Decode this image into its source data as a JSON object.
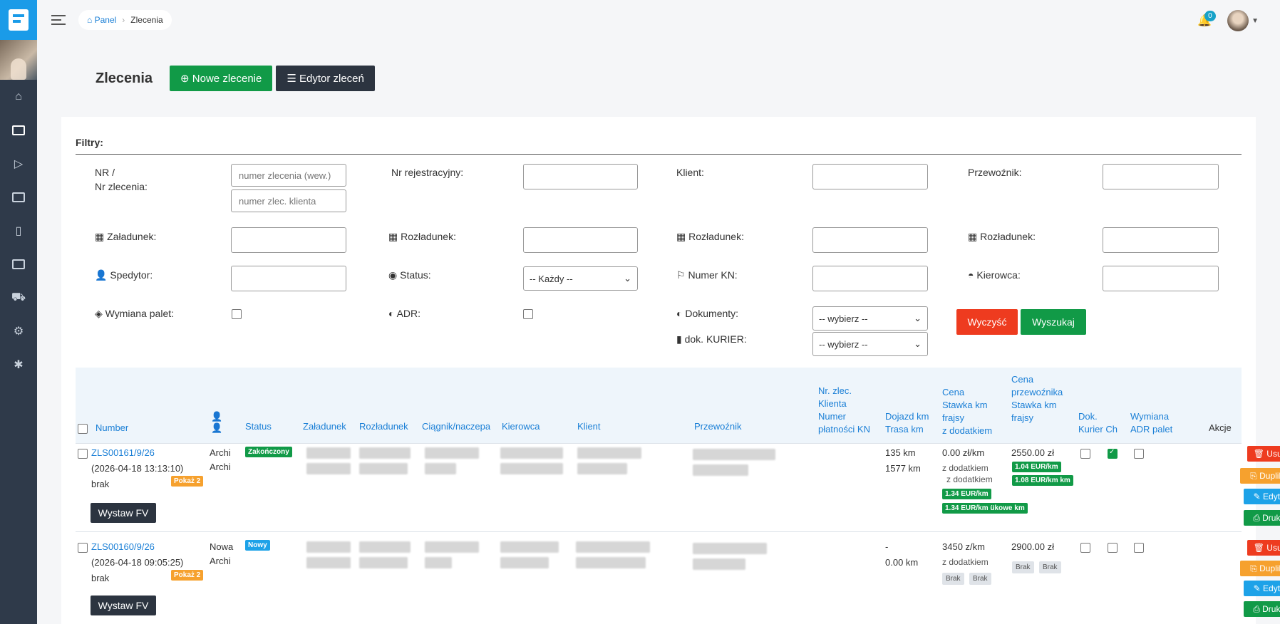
{
  "breadcrumb": {
    "home": "Panel",
    "current": "Zlecenia"
  },
  "notifications": {
    "count": "0"
  },
  "page": {
    "title": "Zlecenia",
    "new_order": "Nowe zlecenie",
    "order_editor": "Edytor zleceń"
  },
  "filters": {
    "title": "Filtry:",
    "nr_label_1": "NR /",
    "nr_label_2": "Nr zlecenia:",
    "nr_internal_placeholder": "numer zlecenia (wew.)",
    "nr_client_placeholder": "numer zlec. klienta",
    "nr_rej": "Nr rejestracyjny:",
    "klient": "Klient:",
    "przewoznik": "Przewoźnik:",
    "zaladunek": "Załadunek:",
    "rozladunek_1": "Rozładunek:",
    "rozladunek_2": "Rozładunek:",
    "rozladunek_3": "Rozładunek:",
    "spedytor": "Spedytor:",
    "status": "Status:",
    "status_value": "-- Każdy --",
    "numer_kn": "Numer KN:",
    "kierowca": "Kierowca:",
    "wymiana_palet": "Wymiana palet:",
    "adr": "ADR:",
    "dokumenty": "Dokumenty:",
    "dokumenty_value": "-- wybierz --",
    "dok_kurier": "dok. KURIER:",
    "dok_kurier_value": "-- wybierz --",
    "clear": "Wyczyść",
    "search": "Wyszukaj"
  },
  "table": {
    "headers": {
      "number": "Number",
      "status": "Status",
      "zaladunek": "Załadunek",
      "rozladunek": "Rozładunek",
      "ciegnik": "Ciągnik/naczepa",
      "kierowca": "Kierowca",
      "klient": "Klient",
      "przewoznik": "Przewoźnik",
      "nr_zlec_1": "Nr. zlec.",
      "nr_zlec_2": "Klienta",
      "nr_zlec_3": "Numer",
      "nr_zlec_4": "płatności KN",
      "dojazd_1": "Dojazd km",
      "dojazd_2": "Trasa km",
      "cena_1": "Cena",
      "cena_2": "Stawka km",
      "cena_3": "frajsy",
      "cena_4": "z dodatkiem",
      "cp_1": "Cena",
      "cp_2": "przewoźnika",
      "cp_3": "Stawka km",
      "cp_4": "frajsy",
      "dok_1": "Dok.",
      "dok_2": "Kurier",
      "dok_3": "Ch",
      "wym_1": "Wymiana",
      "wym_2": "ADR palet",
      "akcje": "Akcje"
    },
    "rows": [
      {
        "number": "ZLS00161/9/26",
        "date": "(2026-04-18 13:13:10)",
        "brak": "brak",
        "show": "Pokaż 2",
        "invoice": "Wystaw FV",
        "sp1": "Archi",
        "sp2": "Archi",
        "status": "Zakończony",
        "dojazd": "135 km",
        "trasa": "1577 km",
        "price": "0.00 zł/km",
        "z_dod": "z dodatkiem",
        "z_dod2": "z dodatkiem",
        "eur1": "1.34 EUR/km",
        "eur2": "1.34 EUR/km",
        "eur2_suffix": "ükowe km",
        "carrier_price": "2550.00 zł",
        "c_eur1": "1.04 EUR/km",
        "c_eur2": "1.08 EUR/km km",
        "delete": "Usuń",
        "duplicate": "Duplikuj",
        "edit": "Edytuj",
        "print": "Drukuj"
      },
      {
        "number": "ZLS00160/9/26",
        "date": "(2026-04-18 09:05:25)",
        "brak": "brak",
        "show": "Pokaż 2",
        "invoice": "Wystaw FV",
        "sp1": "Nowa",
        "sp2": "Archi",
        "status": "Nowy",
        "dojazd": "-",
        "trasa": "0.00 km",
        "price": "3450 z/km",
        "z_dod": "z dodatkiem",
        "brak1": "Brak",
        "brak2": "Brak",
        "carrier_price": "2900.00 zł",
        "c_brak1": "Brak",
        "c_brak2": "Brak",
        "delete": "Usuń",
        "duplicate": "Duplikuj",
        "edit": "Edytuj",
        "print": "Drukuj"
      }
    ]
  },
  "colors": {
    "primary_blue": "#1a7fd6",
    "green": "#119a47",
    "red": "#ee3b1f",
    "orange": "#f6a12e",
    "dark": "#2c3440",
    "sidebar": "#2f3a4a"
  }
}
